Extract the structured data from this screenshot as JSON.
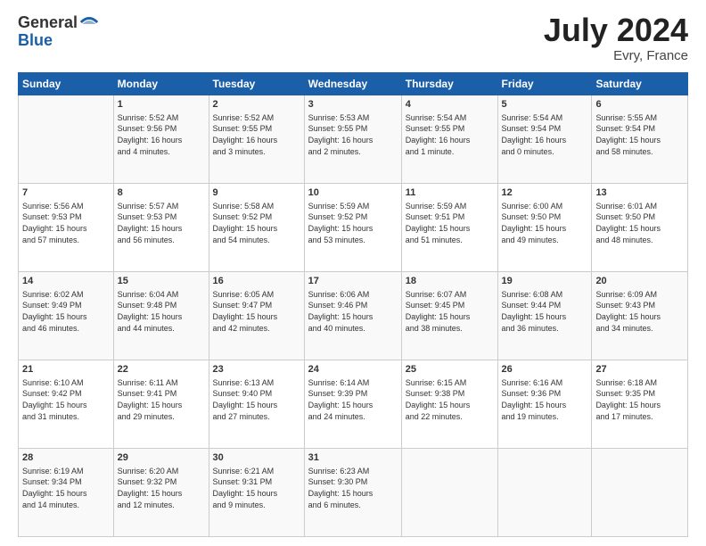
{
  "logo": {
    "general": "General",
    "blue": "Blue"
  },
  "title": "July 2024",
  "location": "Evry, France",
  "days_header": [
    "Sunday",
    "Monday",
    "Tuesday",
    "Wednesday",
    "Thursday",
    "Friday",
    "Saturday"
  ],
  "weeks": [
    [
      {
        "day": "",
        "content": ""
      },
      {
        "day": "1",
        "content": "Sunrise: 5:52 AM\nSunset: 9:56 PM\nDaylight: 16 hours\nand 4 minutes."
      },
      {
        "day": "2",
        "content": "Sunrise: 5:52 AM\nSunset: 9:55 PM\nDaylight: 16 hours\nand 3 minutes."
      },
      {
        "day": "3",
        "content": "Sunrise: 5:53 AM\nSunset: 9:55 PM\nDaylight: 16 hours\nand 2 minutes."
      },
      {
        "day": "4",
        "content": "Sunrise: 5:54 AM\nSunset: 9:55 PM\nDaylight: 16 hours\nand 1 minute."
      },
      {
        "day": "5",
        "content": "Sunrise: 5:54 AM\nSunset: 9:54 PM\nDaylight: 16 hours\nand 0 minutes."
      },
      {
        "day": "6",
        "content": "Sunrise: 5:55 AM\nSunset: 9:54 PM\nDaylight: 15 hours\nand 58 minutes."
      }
    ],
    [
      {
        "day": "7",
        "content": "Sunrise: 5:56 AM\nSunset: 9:53 PM\nDaylight: 15 hours\nand 57 minutes."
      },
      {
        "day": "8",
        "content": "Sunrise: 5:57 AM\nSunset: 9:53 PM\nDaylight: 15 hours\nand 56 minutes."
      },
      {
        "day": "9",
        "content": "Sunrise: 5:58 AM\nSunset: 9:52 PM\nDaylight: 15 hours\nand 54 minutes."
      },
      {
        "day": "10",
        "content": "Sunrise: 5:59 AM\nSunset: 9:52 PM\nDaylight: 15 hours\nand 53 minutes."
      },
      {
        "day": "11",
        "content": "Sunrise: 5:59 AM\nSunset: 9:51 PM\nDaylight: 15 hours\nand 51 minutes."
      },
      {
        "day": "12",
        "content": "Sunrise: 6:00 AM\nSunset: 9:50 PM\nDaylight: 15 hours\nand 49 minutes."
      },
      {
        "day": "13",
        "content": "Sunrise: 6:01 AM\nSunset: 9:50 PM\nDaylight: 15 hours\nand 48 minutes."
      }
    ],
    [
      {
        "day": "14",
        "content": "Sunrise: 6:02 AM\nSunset: 9:49 PM\nDaylight: 15 hours\nand 46 minutes."
      },
      {
        "day": "15",
        "content": "Sunrise: 6:04 AM\nSunset: 9:48 PM\nDaylight: 15 hours\nand 44 minutes."
      },
      {
        "day": "16",
        "content": "Sunrise: 6:05 AM\nSunset: 9:47 PM\nDaylight: 15 hours\nand 42 minutes."
      },
      {
        "day": "17",
        "content": "Sunrise: 6:06 AM\nSunset: 9:46 PM\nDaylight: 15 hours\nand 40 minutes."
      },
      {
        "day": "18",
        "content": "Sunrise: 6:07 AM\nSunset: 9:45 PM\nDaylight: 15 hours\nand 38 minutes."
      },
      {
        "day": "19",
        "content": "Sunrise: 6:08 AM\nSunset: 9:44 PM\nDaylight: 15 hours\nand 36 minutes."
      },
      {
        "day": "20",
        "content": "Sunrise: 6:09 AM\nSunset: 9:43 PM\nDaylight: 15 hours\nand 34 minutes."
      }
    ],
    [
      {
        "day": "21",
        "content": "Sunrise: 6:10 AM\nSunset: 9:42 PM\nDaylight: 15 hours\nand 31 minutes."
      },
      {
        "day": "22",
        "content": "Sunrise: 6:11 AM\nSunset: 9:41 PM\nDaylight: 15 hours\nand 29 minutes."
      },
      {
        "day": "23",
        "content": "Sunrise: 6:13 AM\nSunset: 9:40 PM\nDaylight: 15 hours\nand 27 minutes."
      },
      {
        "day": "24",
        "content": "Sunrise: 6:14 AM\nSunset: 9:39 PM\nDaylight: 15 hours\nand 24 minutes."
      },
      {
        "day": "25",
        "content": "Sunrise: 6:15 AM\nSunset: 9:38 PM\nDaylight: 15 hours\nand 22 minutes."
      },
      {
        "day": "26",
        "content": "Sunrise: 6:16 AM\nSunset: 9:36 PM\nDaylight: 15 hours\nand 19 minutes."
      },
      {
        "day": "27",
        "content": "Sunrise: 6:18 AM\nSunset: 9:35 PM\nDaylight: 15 hours\nand 17 minutes."
      }
    ],
    [
      {
        "day": "28",
        "content": "Sunrise: 6:19 AM\nSunset: 9:34 PM\nDaylight: 15 hours\nand 14 minutes."
      },
      {
        "day": "29",
        "content": "Sunrise: 6:20 AM\nSunset: 9:32 PM\nDaylight: 15 hours\nand 12 minutes."
      },
      {
        "day": "30",
        "content": "Sunrise: 6:21 AM\nSunset: 9:31 PM\nDaylight: 15 hours\nand 9 minutes."
      },
      {
        "day": "31",
        "content": "Sunrise: 6:23 AM\nSunset: 9:30 PM\nDaylight: 15 hours\nand 6 minutes."
      },
      {
        "day": "",
        "content": ""
      },
      {
        "day": "",
        "content": ""
      },
      {
        "day": "",
        "content": ""
      }
    ]
  ]
}
